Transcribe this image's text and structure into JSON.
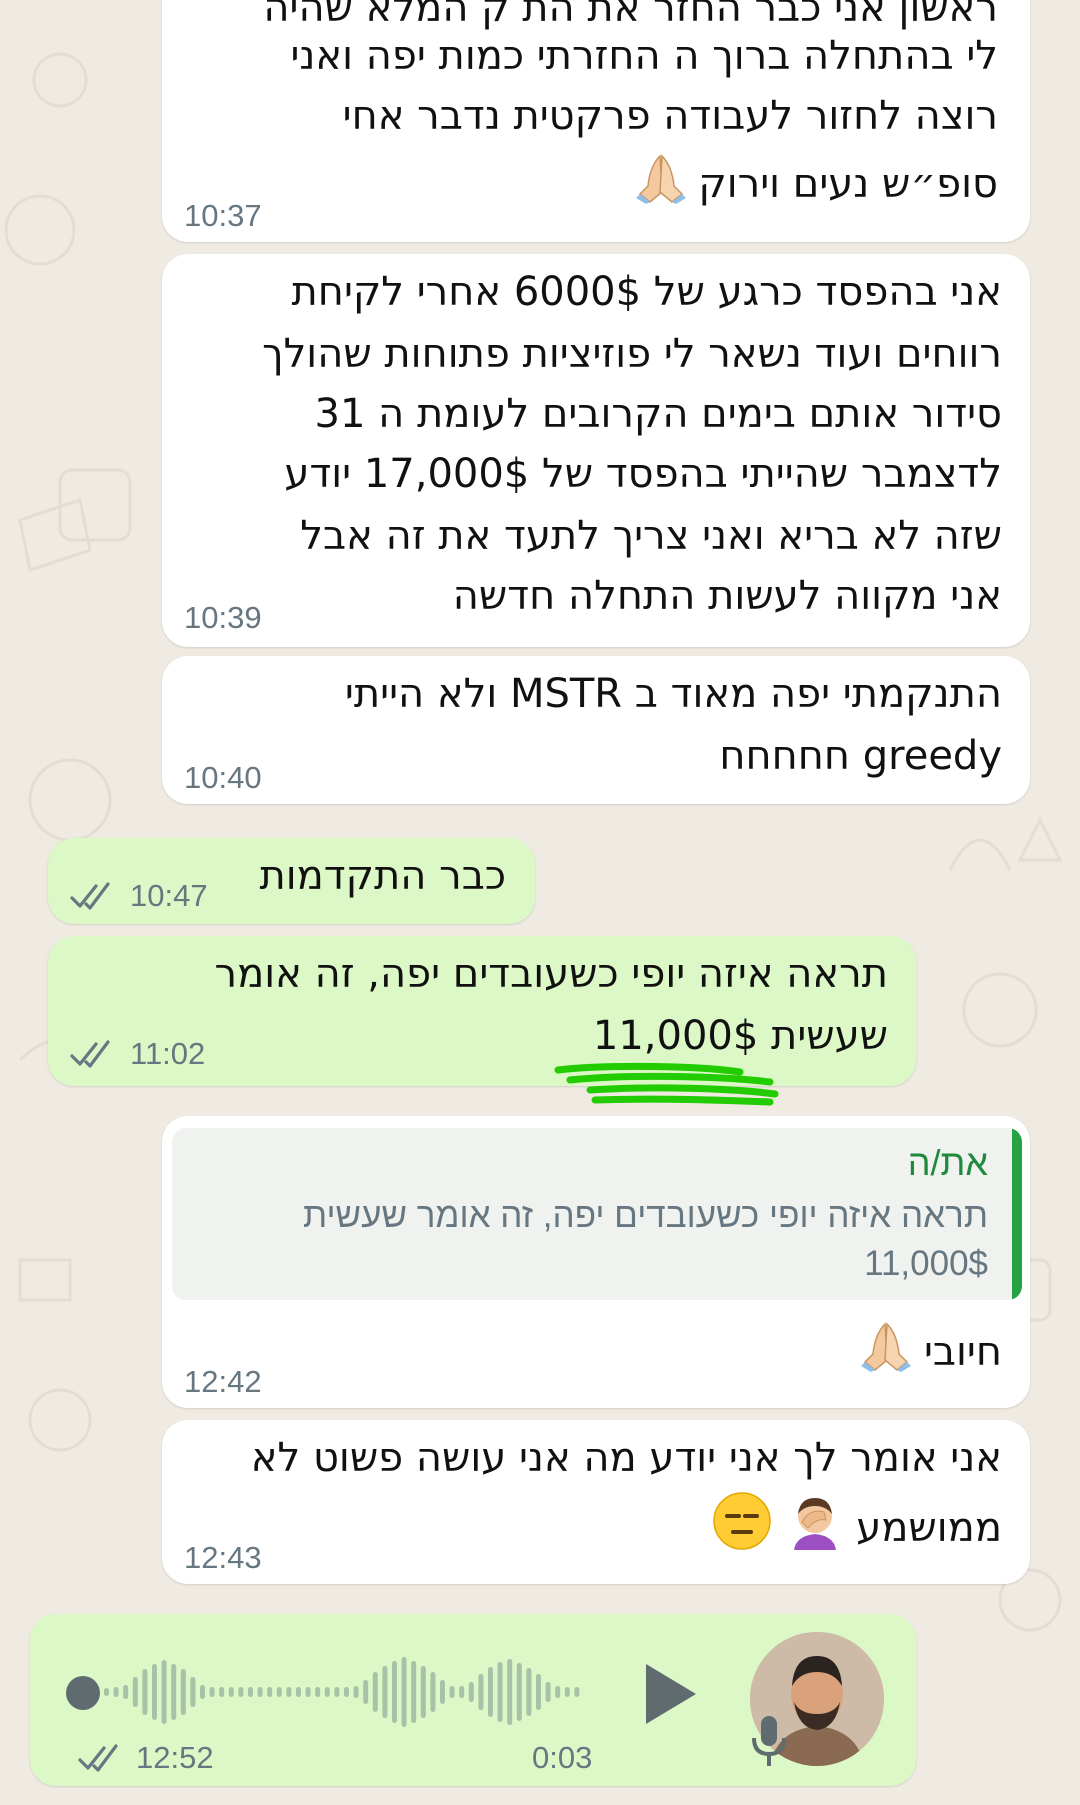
{
  "colors": {
    "background": "#efeae2",
    "incoming_bubble": "#ffffff",
    "outgoing_bubble": "#dcf8c6",
    "quote_bar": "#25a244",
    "highlight_scribble": "#22cc00",
    "tick_color": "#667781"
  },
  "messages": [
    {
      "lines": [
        "ראשון אני כבר החזר את הת ק המלא שהיה",
        "לי בהתחלה ברוך ה החזרתי כמות יפה ואני",
        "רוצה לחזור לעבודה פרקטית נדבר אחי",
        "סופ״ש נעים וירוק"
      ],
      "emoji": "folded-hands",
      "time": "10:37"
    },
    {
      "lines": [
        "אני בהפסד כרגע של 6000$ אחרי לקיחת",
        "רווחים ועוד נשאר לי פוזיציות פתוחות שהולך",
        "סידור אותם בימים הקרובים לעומת ה 31",
        "לדצמבר שהייתי בהפסד של 17,000$ יודע",
        "שזה לא בריא ואני צריך לתעד את זה אבל",
        "אני מקווה לעשות התחלה חדשה"
      ],
      "time": "10:39"
    },
    {
      "lines": [
        "התנקמתי יפה מאוד ב MSTR ולא הייתי",
        "greedy חחחחח"
      ],
      "time": "10:40"
    },
    {
      "lines": [
        "כבר התקדמות"
      ],
      "time": "10:47",
      "status": "read"
    },
    {
      "lines": [
        "תראה איזה יופי כשעובדים יפה, זה אומר",
        "שעשית 11,000$"
      ],
      "time": "11:02",
      "status": "read"
    },
    {
      "quote_author": "את/ה",
      "quote_lines": [
        "תראה איזה יופי כשעובדים יפה, זה אומר שעשית",
        "11,000$"
      ],
      "lines": [
        "חיובי"
      ],
      "emoji": "folded-hands",
      "time": "12:42"
    },
    {
      "lines": [
        "אני אומר לך אני יודע מה אני עושה פשוט לא",
        "ממושמע"
      ],
      "emoji": "facepalm expressionless",
      "time": "12:43"
    },
    {
      "voice_duration": "0:03",
      "time": "12:52",
      "status": "read"
    }
  ]
}
